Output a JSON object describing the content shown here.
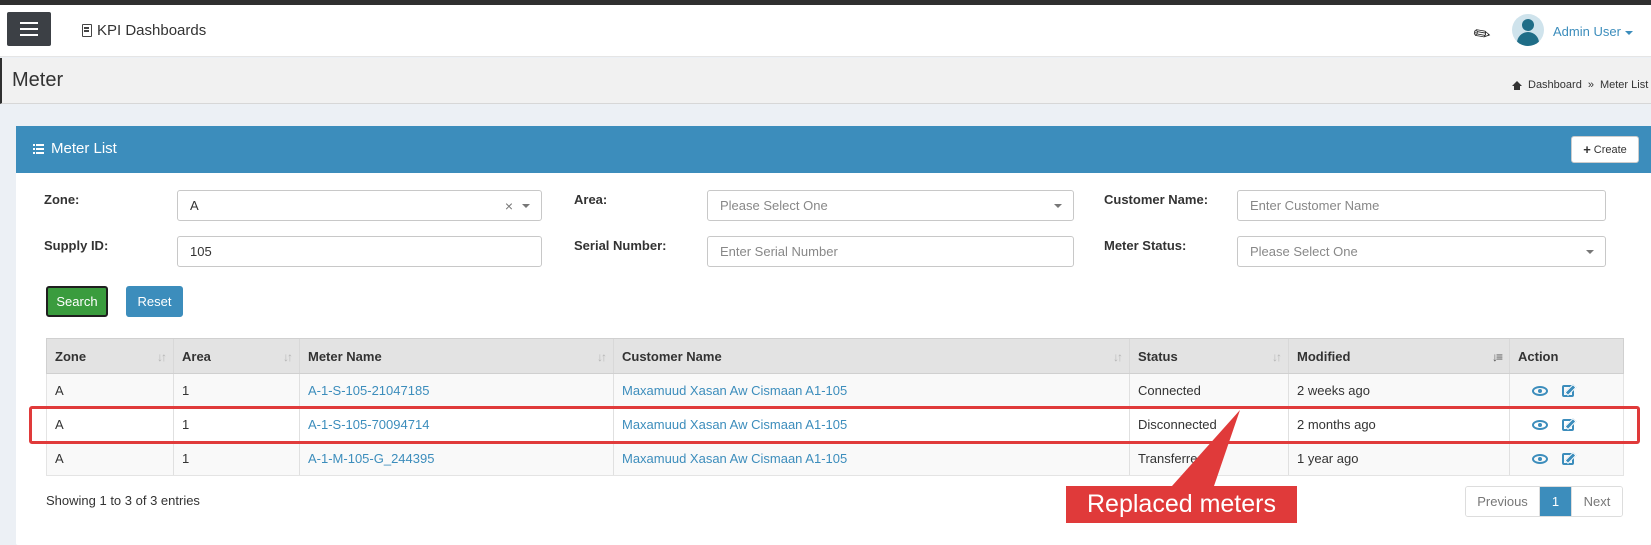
{
  "app": {
    "brand": "KPI Dashboards"
  },
  "user": {
    "name": "Admin User"
  },
  "page": {
    "title": "Meter"
  },
  "breadcrumb": {
    "home": "Dashboard",
    "separator": "»",
    "current": "Meter List"
  },
  "box": {
    "title": "Meter List",
    "create_label": "Create"
  },
  "filters": {
    "zone_label": "Zone:",
    "zone_value": "A",
    "area_label": "Area:",
    "area_placeholder": "Please Select One",
    "customer_label": "Customer Name:",
    "customer_placeholder": "Enter Customer Name",
    "supply_label": "Supply ID:",
    "supply_value": "105",
    "serial_label": "Serial Number:",
    "serial_placeholder": "Enter Serial Number",
    "status_label": "Meter Status:",
    "status_placeholder": "Please Select One"
  },
  "buttons": {
    "search": "Search",
    "reset": "Reset"
  },
  "table": {
    "headers": [
      "Zone",
      "Area",
      "Meter Name",
      "Customer Name",
      "Status",
      "Modified",
      "Action"
    ],
    "rows": [
      {
        "zone": "A",
        "area": "1",
        "meter": "A-1-S-105-21047185",
        "customer": "Maxamuud Xasan Aw Cismaan A1-105",
        "status": "Connected",
        "modified": "2 weeks ago"
      },
      {
        "zone": "A",
        "area": "1",
        "meter": "A-1-S-105-70094714",
        "customer": "Maxamuud Xasan Aw Cismaan A1-105",
        "status": "Disconnected",
        "modified": "2 months ago"
      },
      {
        "zone": "A",
        "area": "1",
        "meter": "A-1-M-105-G_244395",
        "customer": "Maxamuud Xasan Aw Cismaan A1-105",
        "status": "Transferred",
        "modified": "1 year ago"
      }
    ]
  },
  "annotation": {
    "callout_text": "Replaced meters",
    "color": "#e03a3a"
  },
  "footer": {
    "info": "Showing 1 to 3 of 3 entries"
  },
  "pagination": {
    "previous": "Previous",
    "current": "1",
    "next": "Next"
  },
  "colors": {
    "primary": "#3c8dbc",
    "success": "#3a9c3e",
    "dark": "#3c4045"
  }
}
